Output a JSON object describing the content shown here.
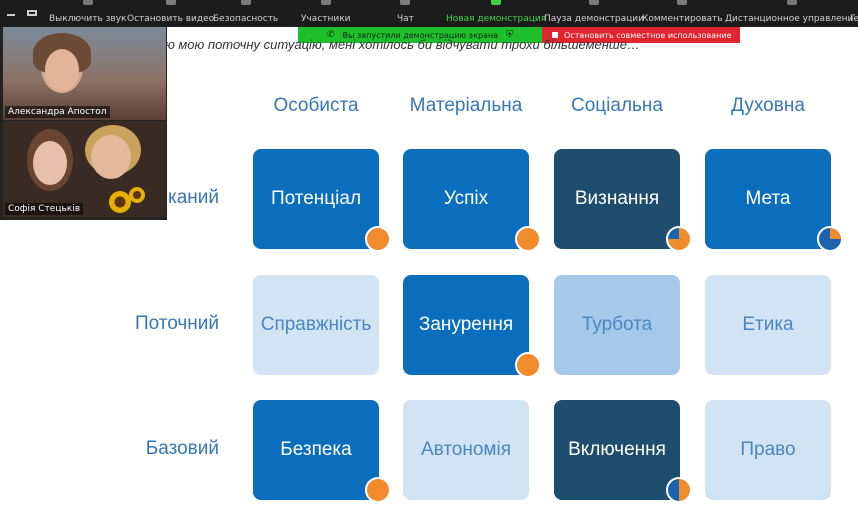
{
  "toolbar": {
    "items": [
      "Выключить звук",
      "Остановить видео",
      "Безопасность",
      "Участники",
      "Чат",
      "Новая демонстрация",
      "Пауза демонстрации",
      "Комментировать",
      "Дистанционное управление",
      "Г"
    ]
  },
  "share": {
    "started_text": "Вы запустили демонстрацию экрана",
    "stop_text": "Остановить совместное использование"
  },
  "slide": {
    "subtitle": "ю мою поточну ситуацію, мені хотілось би відчувати трохи більшеменше…",
    "columns": [
      "Особиста",
      "Матеріальна",
      "Соціальна",
      "Духовна"
    ],
    "rows": [
      "каний",
      "Поточний",
      "Базовий"
    ],
    "cards": [
      [
        "Потенціал",
        "Успіх",
        "Визнання",
        "Мета"
      ],
      [
        "Справжність",
        "Занурення",
        "Турбота",
        "Етика"
      ],
      [
        "Безпека",
        "Автономія",
        "Включення",
        "Право"
      ]
    ],
    "colors": {
      "blue": "#0a6ebd",
      "navy": "#1e4d6e",
      "mid": "#a7c9e9",
      "light": "#d2e3f4",
      "orange": "#f08c2c",
      "label": "#3777b5"
    }
  },
  "videos": {
    "participant1": "Александра Апостол",
    "participant2": "Софія Стецьків"
  }
}
